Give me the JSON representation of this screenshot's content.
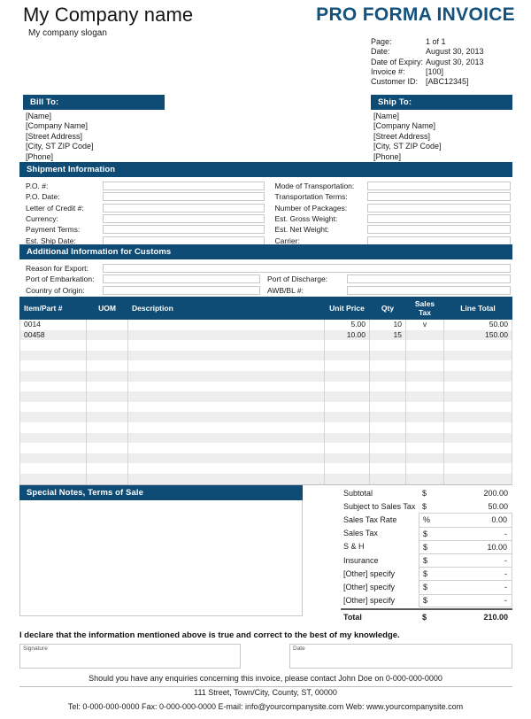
{
  "header": {
    "company_name": "My Company name",
    "company_slogan": "My company slogan",
    "document_title": "PRO FORMA INVOICE"
  },
  "meta": {
    "rows": [
      {
        "label": "Page:",
        "value": "1 of 1"
      },
      {
        "label": "Date:",
        "value": "August 30, 2013"
      },
      {
        "label": "Date of Expiry:",
        "value": "August 30, 2013"
      },
      {
        "label": "Invoice #:",
        "value": "[100]"
      },
      {
        "label": "Customer ID:",
        "value": "[ABC12345]"
      }
    ]
  },
  "bill_to": {
    "title": "Bill To:",
    "lines": [
      "[Name]",
      "[Company Name]",
      "[Street Address]",
      "[City, ST  ZIP Code]",
      "[Phone]"
    ]
  },
  "ship_to": {
    "title": "Ship To:",
    "lines": [
      "[Name]",
      "[Company Name]",
      "[Street Address]",
      "[City, ST  ZIP Code]",
      "[Phone]"
    ]
  },
  "shipment": {
    "title": "Shipment Information",
    "left_fields": [
      {
        "label": "P.O. #:",
        "value": ""
      },
      {
        "label": "P.O. Date:",
        "value": ""
      },
      {
        "label": "Letter of Credit #:",
        "value": ""
      },
      {
        "label": "Currency:",
        "value": ""
      },
      {
        "label": "Payment Terms:",
        "value": ""
      },
      {
        "label": "Est. Ship Date:",
        "value": ""
      }
    ],
    "right_fields": [
      {
        "label": "Mode of Transportation:",
        "value": ""
      },
      {
        "label": "Transportation Terms:",
        "value": ""
      },
      {
        "label": "Number of Packages:",
        "value": ""
      },
      {
        "label": "Est. Gross Weight:",
        "value": ""
      },
      {
        "label": "Est. Net Weight:",
        "value": ""
      },
      {
        "label": "Carrier:",
        "value": ""
      }
    ]
  },
  "customs": {
    "title": "Additional Information for Customs",
    "reason": {
      "label": "Reason for Export:",
      "value": ""
    },
    "pairs": [
      {
        "label": "Port of Embarkation:",
        "value": "",
        "label2": "Port of Discharge:",
        "value2": ""
      },
      {
        "label": "Country of Origin:",
        "value": "",
        "label2": "AWB/BL #:",
        "value2": ""
      }
    ]
  },
  "items": {
    "columns": [
      "Item/Part #",
      "UOM",
      "Description",
      "Unit Price",
      "Qty",
      "Sales Tax",
      "Line Total"
    ],
    "rows": [
      {
        "item": "0014",
        "uom": "",
        "desc": "",
        "price": "5.00",
        "qty": "10",
        "tax": "v",
        "total": "50.00"
      },
      {
        "item": "00458",
        "uom": "",
        "desc": "",
        "price": "10.00",
        "qty": "15",
        "tax": "",
        "total": "150.00"
      }
    ],
    "empty_row_count": 14
  },
  "notes": {
    "title": "Special Notes, Terms of Sale",
    "body": ""
  },
  "totals": {
    "rows": [
      {
        "label": "Subtotal",
        "currency": "$",
        "amount": "200.00",
        "boxed": false
      },
      {
        "label": "Subject to Sales Tax",
        "currency": "$",
        "amount": "50.00",
        "boxed": false
      },
      {
        "label": "Sales Tax Rate",
        "currency": "%",
        "amount": "0.00",
        "boxed": true
      },
      {
        "label": "Sales Tax",
        "currency": "$",
        "amount": "-",
        "boxed": true
      },
      {
        "label": "S & H",
        "currency": "$",
        "amount": "10.00",
        "boxed": true
      },
      {
        "label": "Insurance",
        "currency": "$",
        "amount": "-",
        "boxed": true
      },
      {
        "label": "[Other] specify",
        "currency": "$",
        "amount": "-",
        "boxed": true
      },
      {
        "label": "[Other] specify",
        "currency": "$",
        "amount": "-",
        "boxed": true
      },
      {
        "label": "[Other] specify",
        "currency": "$",
        "amount": "-",
        "boxed": true
      }
    ],
    "grand": {
      "label": "Total",
      "currency": "$",
      "amount": "210.00"
    }
  },
  "declaration": {
    "text": "I declare that the information mentioned above is true and correct to the best of my knowledge.",
    "signature_label": "Signature",
    "date_label": "Date"
  },
  "footer": {
    "enquiry": "Should you have any enquiries concerning this invoice, please contact John Doe on 0-000-000-0000",
    "address": "111 Street, Town/City, County, ST, 00000",
    "contact": "Tel: 0-000-000-0000 Fax: 0-000-000-0000 E-mail: info@yourcompanysite.com Web: www.yourcompanysite.com"
  },
  "colors": {
    "accent": "#0e4b75",
    "title": "#14517d",
    "row_alt": "#eeeeee"
  }
}
